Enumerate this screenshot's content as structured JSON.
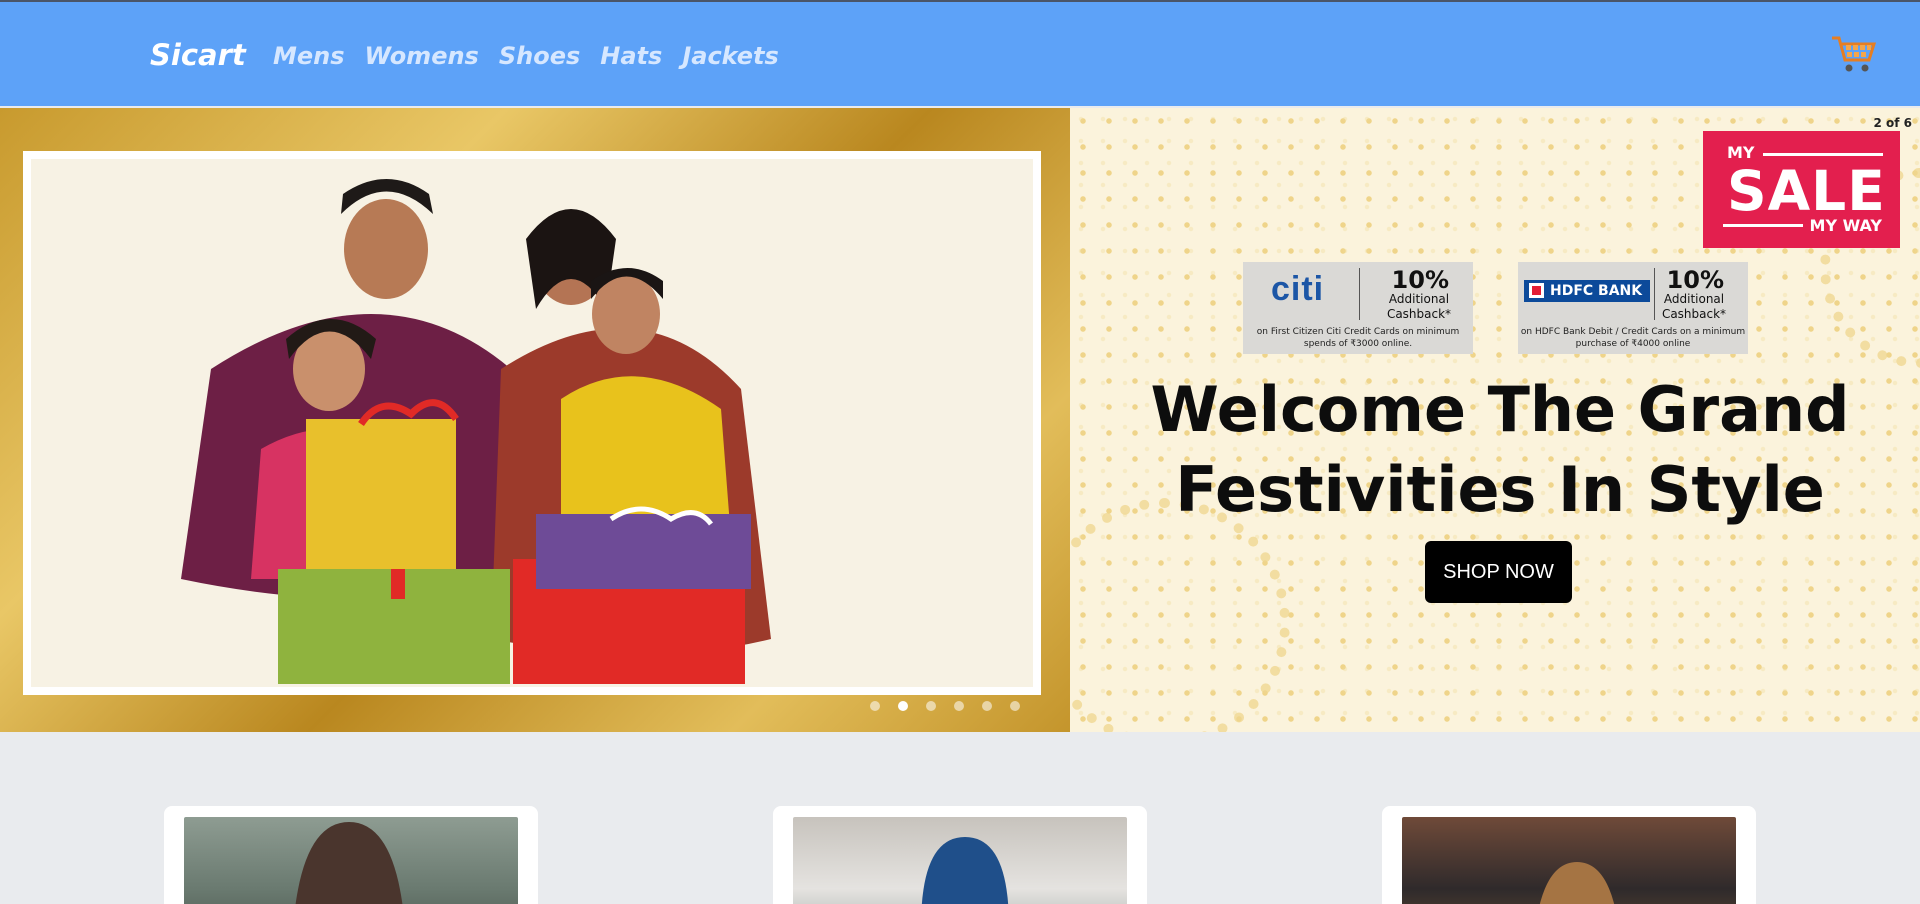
{
  "brand": "Sicart",
  "nav": [
    "Mens",
    "Womens",
    "Shoes",
    "Hats",
    "Jackets"
  ],
  "cart_icon": "shopping-cart-icon",
  "hero": {
    "slide_counter": "2 of 6",
    "sale_badge": {
      "line1": "MY",
      "line2": "SALE",
      "line3": "MY WAY"
    },
    "offers": [
      {
        "bank": "citi",
        "percent": "10%",
        "label": "Additional Cashback*",
        "terms": "on First Citizen Citi Credit Cards on minimum spends of ₹3000 online."
      },
      {
        "bank": "HDFC BANK",
        "percent": "10%",
        "label": "Additional Cashback*",
        "terms": "on HDFC Bank Debit / Credit Cards on a minimum purchase of ₹4000 online"
      }
    ],
    "headline_line1": "Welcome The Grand",
    "headline_line2": "Festivities In Style",
    "cta": "SHOP NOW",
    "dots_active_index": 1,
    "dots_count": 6
  },
  "colors": {
    "navbar": "#5da2f8",
    "sale_badge": "#e31f4e",
    "cta": "#000000"
  }
}
